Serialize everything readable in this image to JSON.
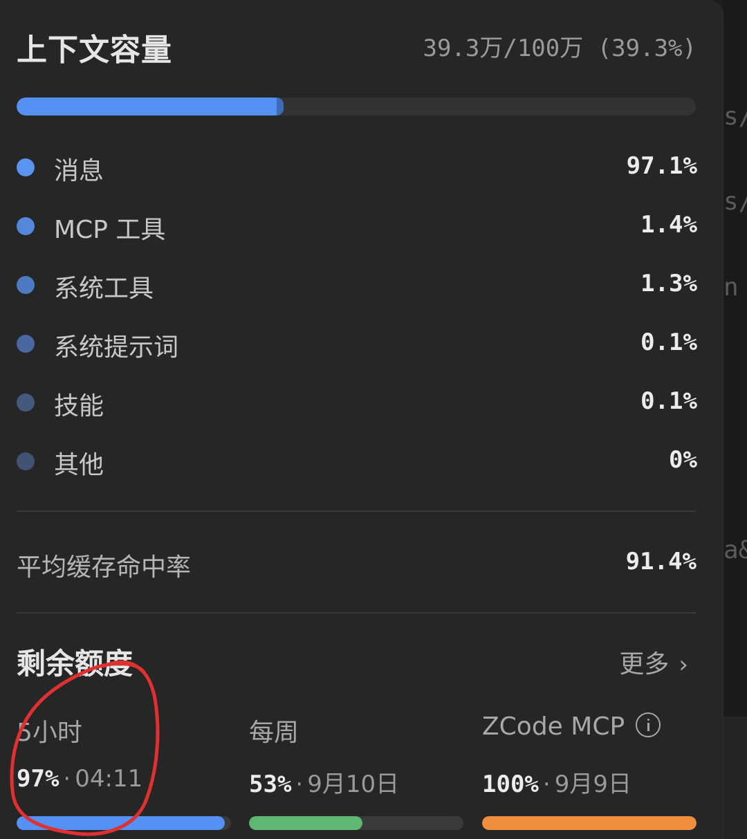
{
  "context": {
    "title": "上下文容量",
    "usage": "39.3万/100万 (39.3%)",
    "fill_fraction": 0.393,
    "colors": {
      "fill": "#5591f3",
      "track": "#333333"
    },
    "items": [
      {
        "label": "消息",
        "value": "97.1%",
        "color": "#5b93f0"
      },
      {
        "label": "MCP 工具",
        "value": "1.4%",
        "color": "#5587dc"
      },
      {
        "label": "系统工具",
        "value": "1.3%",
        "color": "#4e79c3"
      },
      {
        "label": "系统提示词",
        "value": "0.1%",
        "color": "#48689f"
      },
      {
        "label": "技能",
        "value": "0.1%",
        "color": "#45597e"
      },
      {
        "label": "其他",
        "value": "0%",
        "color": "#435174"
      }
    ]
  },
  "cache": {
    "label": "平均缓存命中率",
    "value": "91.4%"
  },
  "quota": {
    "title": "剩余额度",
    "more_label": "更多",
    "more_icon": "chevron-right-icon",
    "items": [
      {
        "label": "5小时",
        "percent": "97%",
        "date": "04:11",
        "fill_fraction": 0.97,
        "color": "#5591f3"
      },
      {
        "label": "每周",
        "percent": "53%",
        "date": "9月10日",
        "fill_fraction": 0.53,
        "color": "#5fb872"
      },
      {
        "label": "ZCode MCP",
        "percent": "100%",
        "date": "9月9日",
        "fill_fraction": 1.0,
        "color": "#ef8e3d",
        "icon": "info-icon"
      }
    ]
  },
  "annotation": {
    "type": "hand-drawn circle",
    "color": "#e03030"
  },
  "background_fragments": [
    "s/",
    "s/",
    "n",
    "a&"
  ]
}
